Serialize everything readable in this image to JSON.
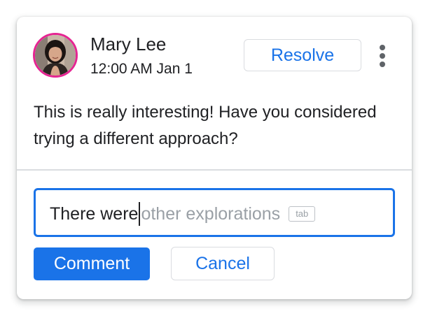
{
  "comment": {
    "author": "Mary Lee",
    "timestamp": "12:00 AM Jan 1",
    "body": "This is really interesting! Have you considered trying a different approach?",
    "avatar_ring_color": "#e52592"
  },
  "actions": {
    "resolve_label": "Resolve",
    "more_icon": "more-vert-icon"
  },
  "reply": {
    "typed_text": "There were",
    "suggestion_text": "other explorations",
    "tab_hint": "tab",
    "focused": true
  },
  "buttons": {
    "comment_label": "Comment",
    "cancel_label": "Cancel"
  },
  "colors": {
    "accent": "#1a73e8",
    "text": "#202124",
    "suggestion": "#9aa0a6",
    "divider": "#dadce0"
  }
}
